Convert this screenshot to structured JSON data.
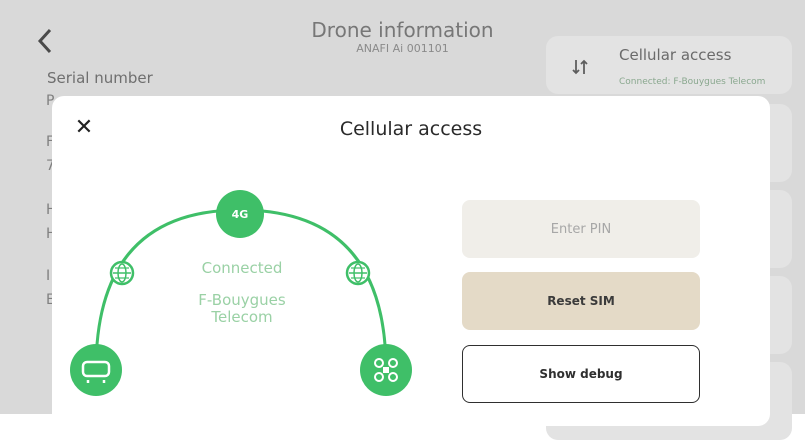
{
  "background": {
    "title": "Drone information",
    "subtitle": "ANAFI Ai 001101",
    "serial_label": "Serial number",
    "peek_chars": [
      "P",
      "F",
      "7",
      "H",
      "H",
      "I",
      "E"
    ],
    "cellular_card": {
      "icon": "arrows-up-down-icon",
      "title": "Cellular access",
      "status": "Connected: F-Bouygues Telecom"
    }
  },
  "modal": {
    "title": "Cellular access",
    "close_glyph": "✕",
    "network_badge": "4G",
    "status": "Connected",
    "operator_line1": "F-Bouygues",
    "operator_line2": "Telecom",
    "buttons": {
      "enter_pin": "Enter PIN",
      "reset_sim": "Reset SIM",
      "show_debug": "Show debug"
    }
  },
  "colors": {
    "accent_green": "#3fbf68",
    "status_green": "#9ad1a5",
    "reset_bg": "#e4dac7",
    "pin_bg": "#f0eee9"
  }
}
